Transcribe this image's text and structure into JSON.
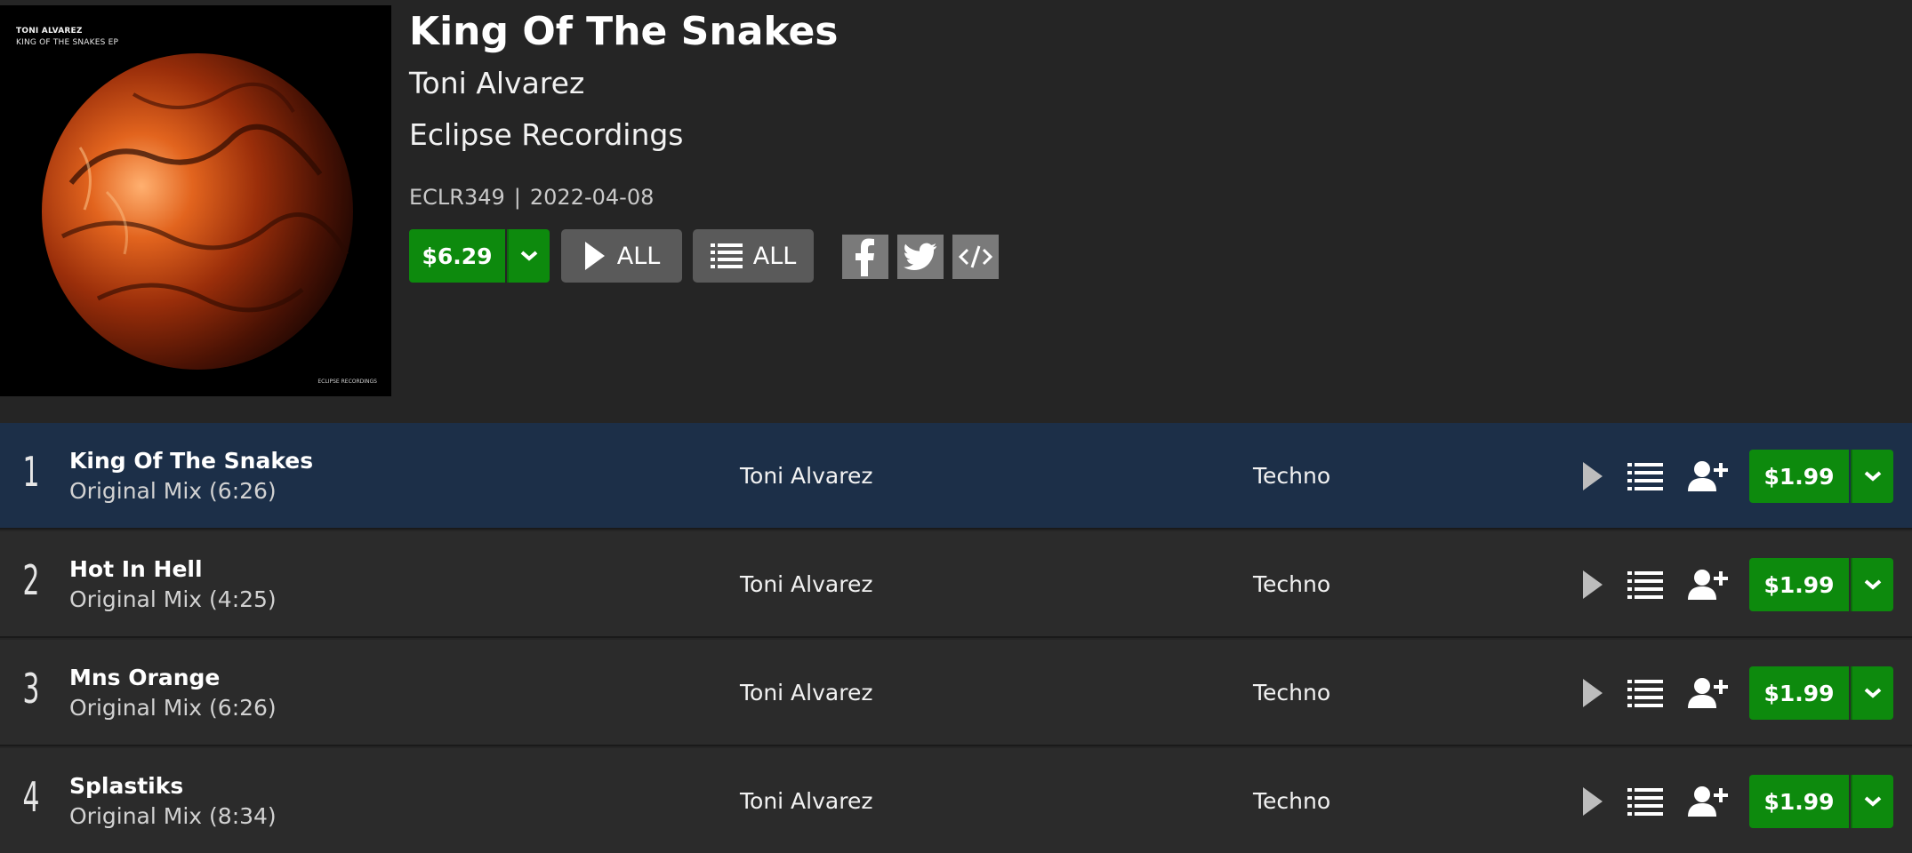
{
  "release": {
    "cover": {
      "artist_text": "TONI ALVAREZ",
      "title_text": "KING OF THE SNAKES EP",
      "label_text": "ECLIPSE RECORDINGS",
      "icon": "planet-artwork"
    },
    "title": "King Of The Snakes",
    "artist": "Toni Alvarez",
    "label": "Eclipse Recordings",
    "catalog": "ECLR349",
    "separator": "|",
    "date": "2022-04-08",
    "price": "$6.29",
    "play_all_label": "ALL",
    "queue_all_label": "ALL",
    "share": {
      "facebook_icon": "facebook-icon",
      "twitter_icon": "twitter-icon",
      "embed_icon": "embed-code-icon"
    }
  },
  "tracks": [
    {
      "number": "1",
      "title": "King Of The Snakes",
      "mix": "Original Mix (6:26)",
      "artist": "Toni Alvarez",
      "genre": "Techno",
      "price": "$1.99",
      "active": true
    },
    {
      "number": "2",
      "title": "Hot In Hell",
      "mix": "Original Mix (4:25)",
      "artist": "Toni Alvarez",
      "genre": "Techno",
      "price": "$1.99",
      "active": false
    },
    {
      "number": "3",
      "title": "Mns Orange",
      "mix": "Original Mix (6:26)",
      "artist": "Toni Alvarez",
      "genre": "Techno",
      "price": "$1.99",
      "active": false
    },
    {
      "number": "4",
      "title": "Splastiks",
      "mix": "Original Mix (8:34)",
      "artist": "Toni Alvarez",
      "genre": "Techno",
      "price": "$1.99",
      "active": false
    }
  ],
  "colors": {
    "background": "#252525",
    "row": "#2b2b2b",
    "row_active": "#1c2f48",
    "buy_green": "#0d8a0d",
    "button_grey": "#5a5a5a",
    "share_grey": "#7a7a7a"
  }
}
